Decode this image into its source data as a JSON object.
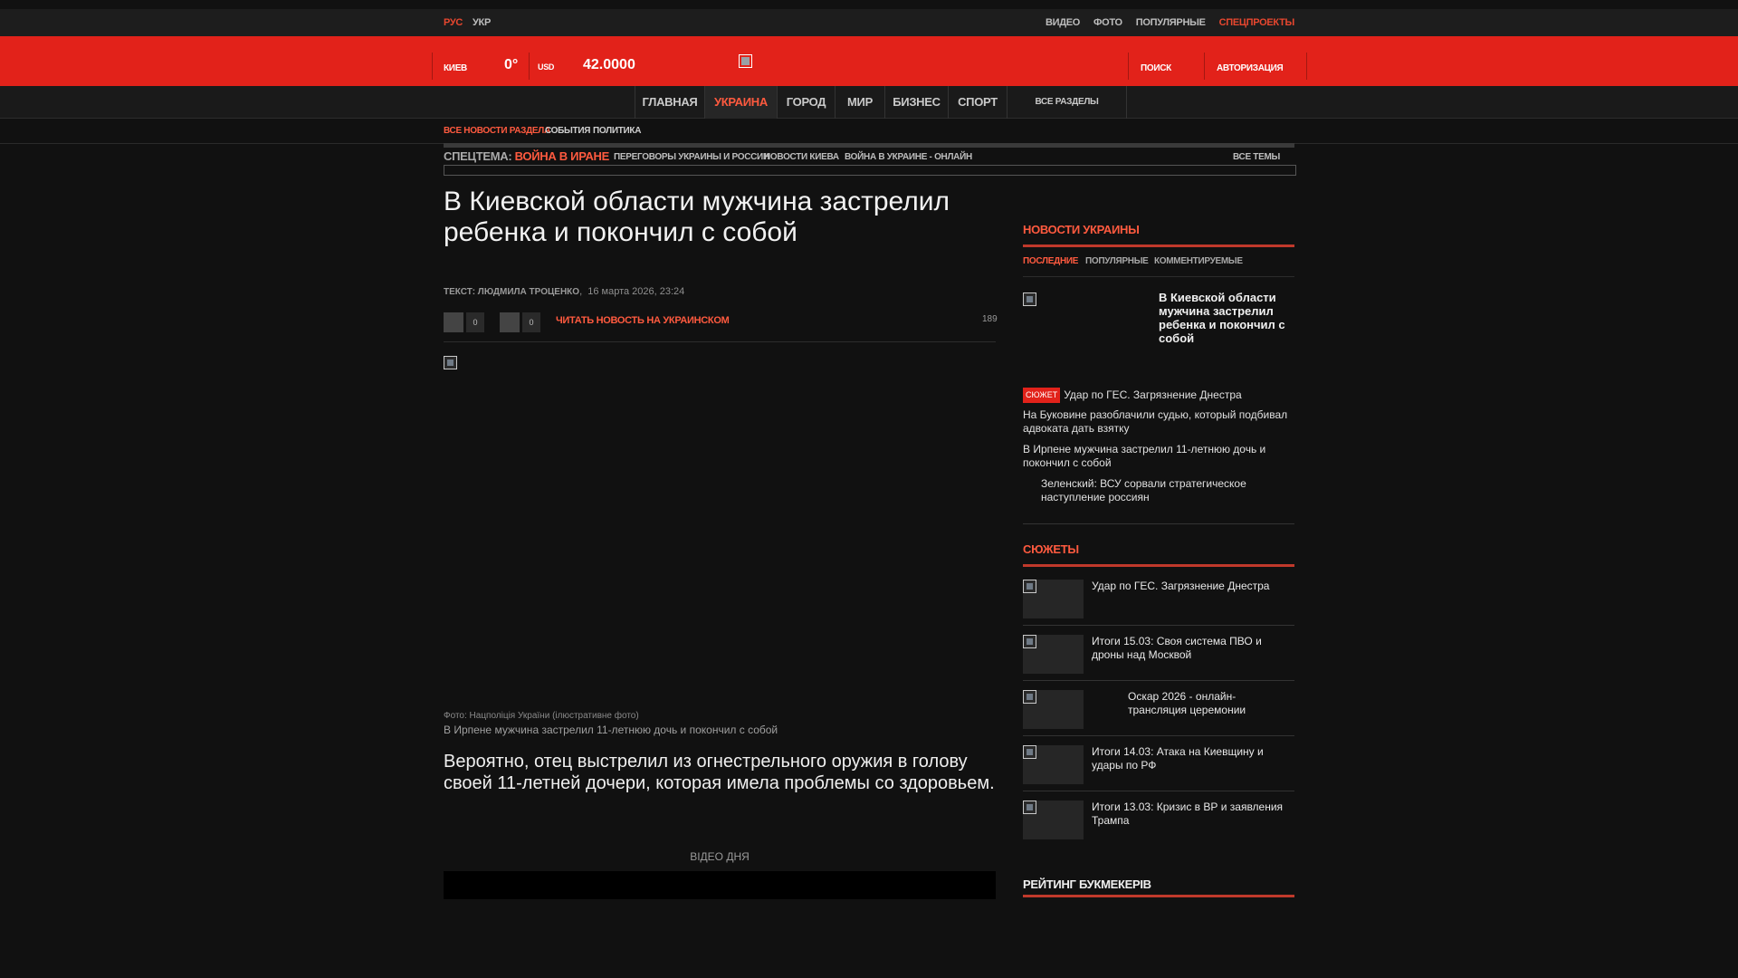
{
  "top_bar": {
    "lang_rus": "РУС",
    "lang_ukr": "УКР",
    "links": [
      {
        "label": "ВИДЕО",
        "accent": false
      },
      {
        "label": "ФОТО",
        "accent": false
      },
      {
        "label": "ПОПУЛЯРНЫЕ",
        "accent": false
      },
      {
        "label": "СПЕЦПРОЕКТЫ",
        "accent": true
      }
    ]
  },
  "header": {
    "city": "КИЕВ",
    "temperature": "0°",
    "currency": "USD",
    "rate": "42.0000",
    "search": "ПОИСК",
    "auth": "АВТОРИЗАЦИЯ"
  },
  "nav": {
    "items": [
      "ГЛАВНАЯ",
      "УКРАИНА",
      "ГОРОД",
      "МИР",
      "БИЗНЕС",
      "СПОРТ"
    ],
    "active_index": 1,
    "all_sections": "ВСЕ РАЗДЕЛЫ"
  },
  "subnav": {
    "all_news": "ВСЕ НОВОСТИ РАЗДЕЛА",
    "events": "СОБЫТИЯ",
    "politics": "ПОЛИТИКА"
  },
  "spectema": {
    "label": "СПЕЦТЕМА:",
    "main": "ВОЙНА В ИРАНЕ",
    "links": [
      "ПЕРЕГОВОРЫ УКРАИНЫ И РОССИИ",
      "НОВОСТИ КИЕВА",
      "ВОЙНА В УКРАИНЕ - ОНЛАЙН"
    ],
    "all_topics": "ВСЕ ТЕМЫ"
  },
  "article": {
    "title": "В Киевской области мужчина застрелил ребенка и покончил с собой",
    "author": "ТЕКСТ: ЛЮДМИЛА ТРОЦЕНКО",
    "date": "16 марта 2026, 23:24",
    "share_count_1": "0",
    "share_count_2": "0",
    "read_ukr": "ЧИТАТЬ НОВОСТЬ НА УКРАИНСКОМ",
    "views": "189",
    "photo_credit": "Фото: Нацполіція України (ілюстративне фото)",
    "photo_caption": "В Ирпене мужчина застрелил 11-летнюю дочь и покончил с собой",
    "lead": "Вероятно, отец выстрелил из огнестрельного оружия в голову своей 11-летней дочери, которая имела проблемы со здоровьем.",
    "video_of_day": "ВІДЕО ДНЯ"
  },
  "sidebar": {
    "news_heading": "НОВОСТИ УКРАИНЫ",
    "tabs": [
      "ПОСЛЕДНИЕ",
      "ПОПУЛЯРНЫЕ",
      "КОММЕНТИРУЕМЫЕ"
    ],
    "featured_title": "В Киевской области мужчина застрелил ребенка и покончил с собой",
    "news": [
      {
        "badge": "СЮЖЕТ",
        "title": "Удар по ГЕС. Загрязнение Днестра"
      },
      {
        "badge": "",
        "title": "На Буковине разоблачили судью, который подбивал адвоката дать взятку"
      },
      {
        "badge": "",
        "title": "В Ирпене мужчина застрелил 11-летнюю дочь и покончил с собой"
      },
      {
        "badge": "",
        "title": "Зеленский: ВСУ сорвали стратегическое наступление россиян"
      }
    ],
    "stories_heading": "СЮЖЕТЫ",
    "stories": [
      "Удар по ГЕС. Загрязнение Днестра",
      "Итоги 15.03: Своя система ПВО и дроны над Москвой",
      "Оскар 2026 - онлайн-трансляция церемонии",
      "Итоги 14.03: Атака на Киевщину и удары по РФ",
      "Итоги 13.03: Кризис в ВР и заявления Трампа"
    ],
    "rating_heading": "РЕЙТИНГ БУКМЕКЕРІВ"
  },
  "colors": {
    "accent": "#e2221a",
    "accent_text": "#ff5a3f",
    "background": "#111111"
  }
}
